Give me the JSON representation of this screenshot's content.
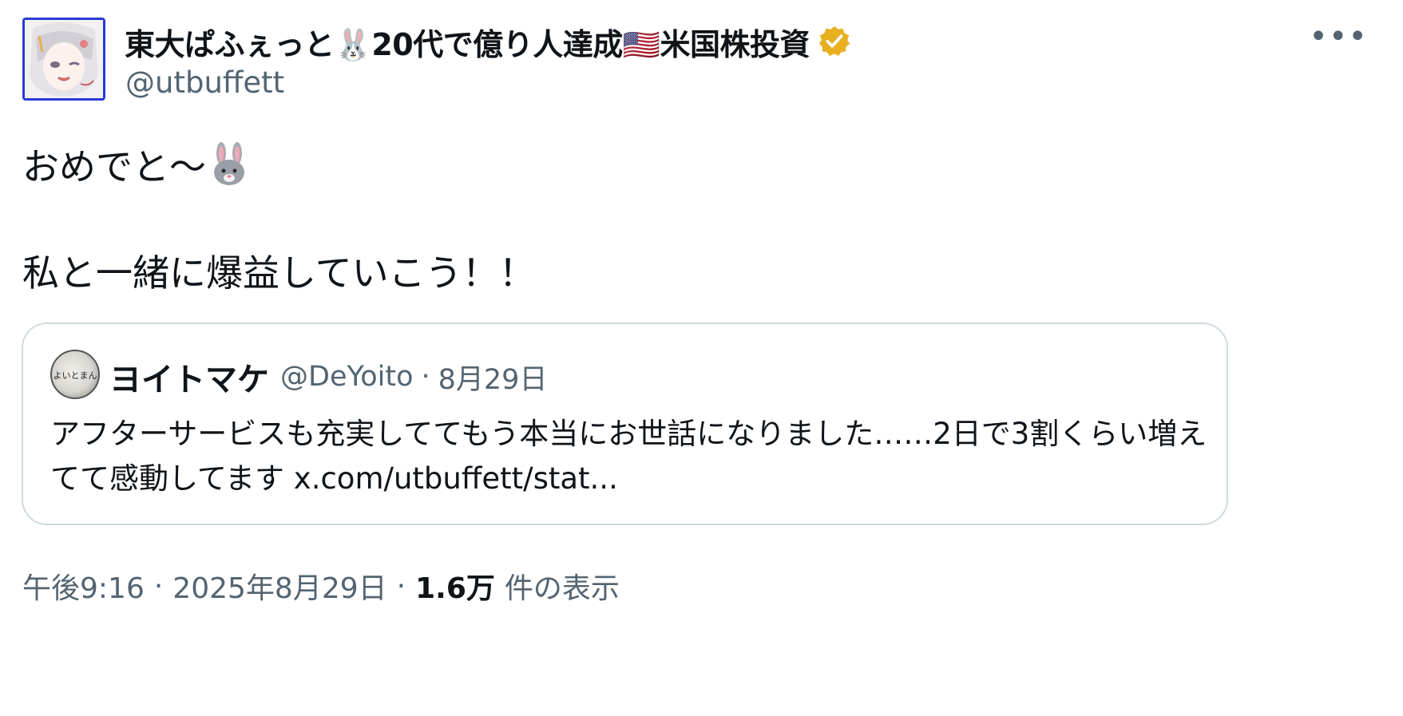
{
  "author": {
    "display_name": "東大ぱふぇっと🐰20代で億り人達成🇺🇸米国株投資",
    "handle": "@utbuffett",
    "verified_color": "#e8b021"
  },
  "tweet": {
    "line1": "おめでと〜",
    "line2": "私と一緒に爆益していこう！！"
  },
  "quote": {
    "avatar_text": "よいとまん",
    "name": "ヨイトマケ",
    "handle": "@DeYoito",
    "separator": "·",
    "date": "8月29日",
    "text": "アフターサービスも充実しててもう本当にお世話になりました……2日で3割くらい増えてて感動してます x.com/utbuffett/stat..."
  },
  "meta": {
    "time": "午後9:16",
    "dot1": "·",
    "date": "2025年8月29日",
    "dot2": "·",
    "views_count": "1.6万",
    "views_label": "件の表示"
  },
  "icons": {
    "more": "more-icon",
    "verified": "verified-badge-icon",
    "bunny": "bunny-emoji-icon"
  },
  "colors": {
    "text_primary": "#0f1419",
    "text_secondary": "#536471",
    "border": "#cfd9de",
    "avatar_border": "#2a3bd6"
  }
}
